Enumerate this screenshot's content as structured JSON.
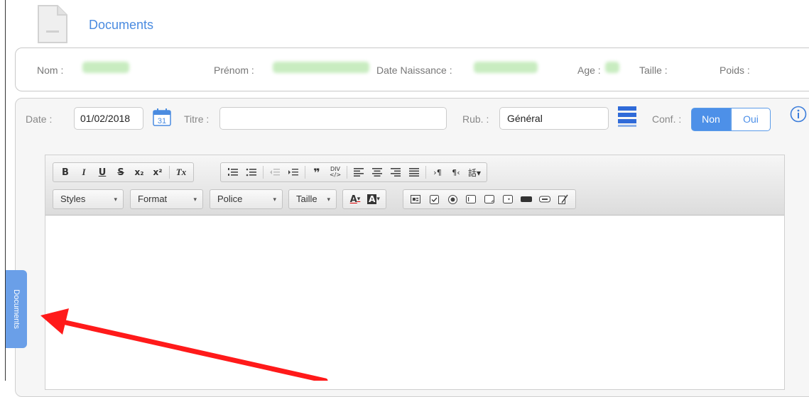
{
  "header": {
    "title": "Documents",
    "icon": "document-icon"
  },
  "patient": {
    "fields": [
      {
        "label": "Nom :"
      },
      {
        "label": "Prénom :"
      },
      {
        "label": "Date Naissance :"
      },
      {
        "label": "Age :"
      },
      {
        "label": "Taille :"
      },
      {
        "label": "Poids :"
      }
    ]
  },
  "form": {
    "date_label": "Date :",
    "date_value": "01/02/2018",
    "calendar_day": "31",
    "titre_label": "Titre :",
    "titre_value": "",
    "rub_label": "Rub. :",
    "rub_value": "Général",
    "conf_label": "Conf. :",
    "conf_options": [
      "Non",
      "Oui"
    ],
    "conf_selected": "Non"
  },
  "editor": {
    "toolbar_row1": [
      "B",
      "I",
      "U",
      "S",
      "x₂",
      "x²",
      "Tx",
      "numbered-list",
      "bulleted-list",
      "outdent",
      "indent",
      "blockquote",
      "div",
      "align-left",
      "align-center",
      "align-right",
      "justify",
      "ltr",
      "rtl",
      "language"
    ],
    "combos": {
      "styles": "Styles",
      "format": "Format",
      "police": "Police",
      "taille": "Taille"
    },
    "text_color": "A",
    "bg_color": "A"
  },
  "side_tab": {
    "label": "Documents"
  },
  "colors": {
    "accent": "#4d90e8",
    "tab": "#6a9fe8",
    "arrow": "#ff1a1a"
  }
}
